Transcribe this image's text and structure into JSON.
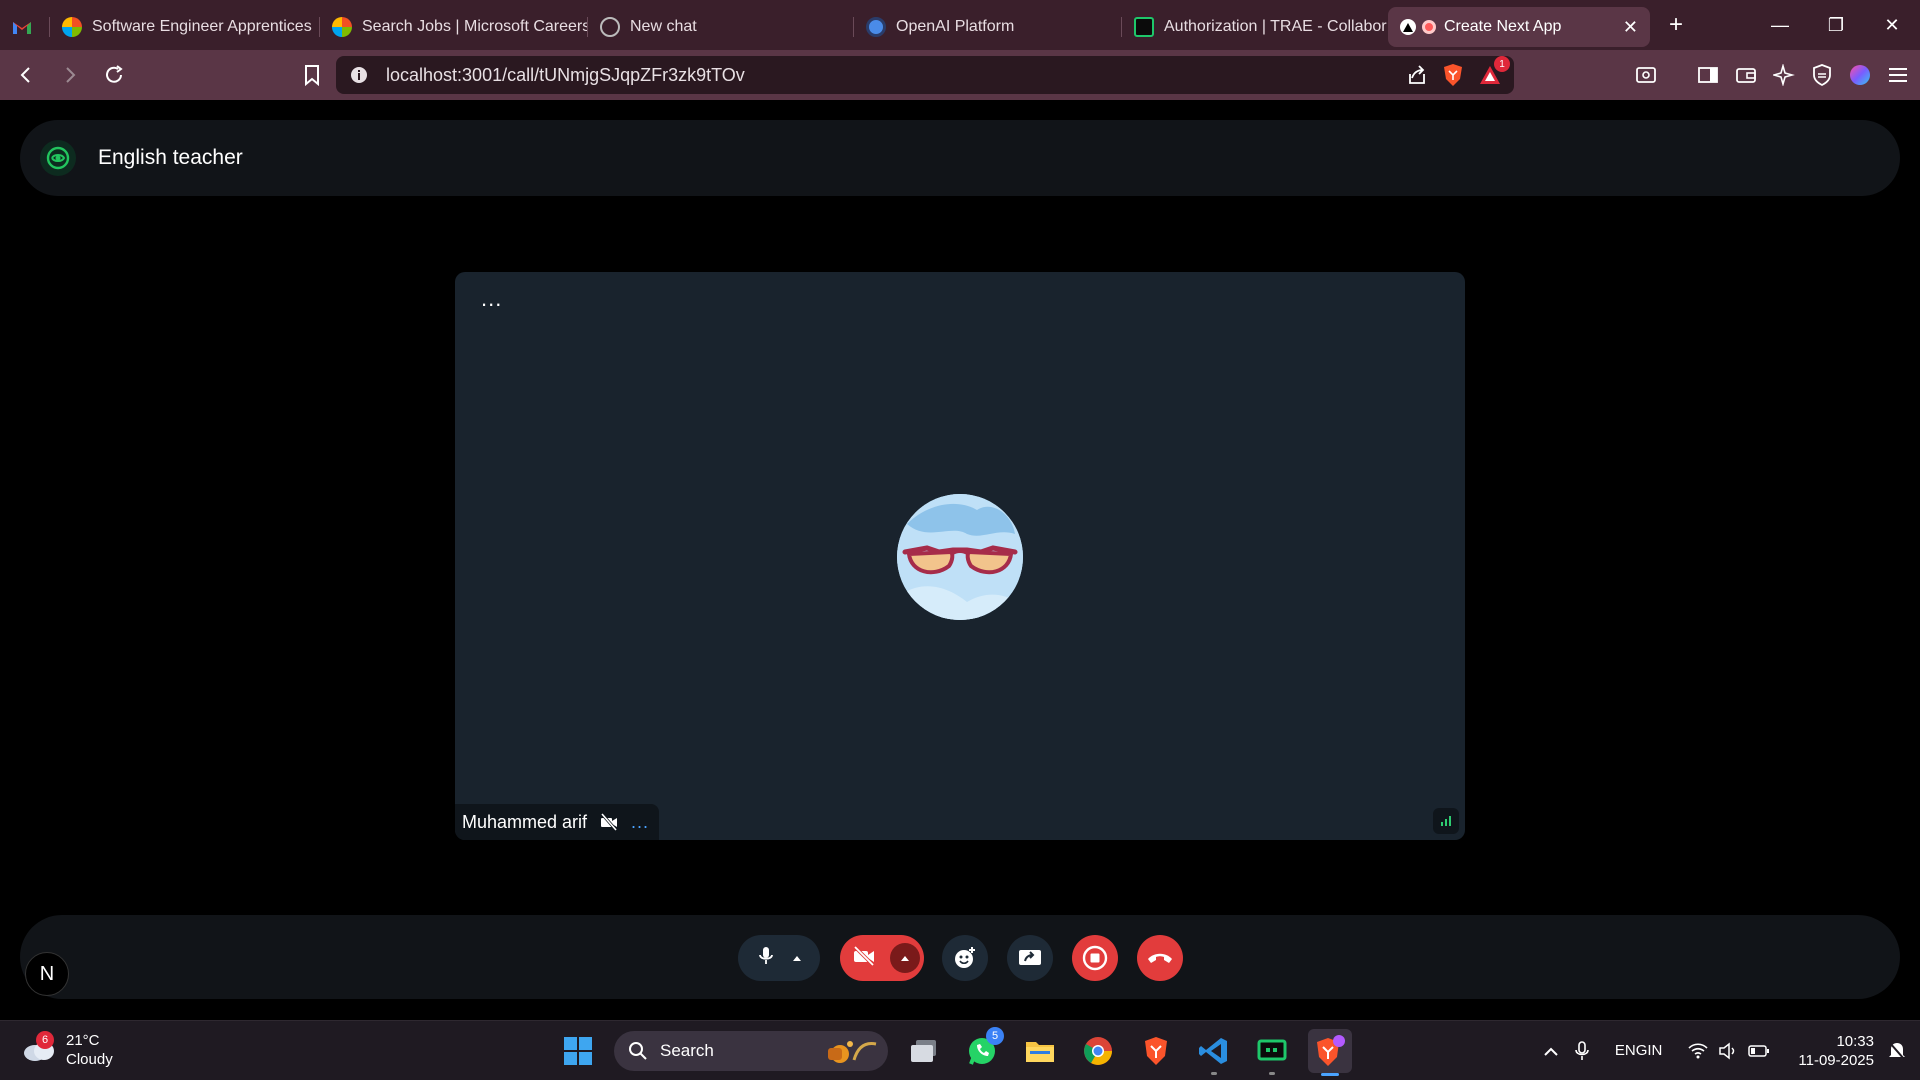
{
  "browser": {
    "tabs": [
      {
        "title": "",
        "icon": "gmail-icon"
      },
      {
        "title": "Software Engineer Apprentices",
        "icon": "microsoft-icon"
      },
      {
        "title": "Search Jobs | Microsoft Careers",
        "icon": "microsoft-icon"
      },
      {
        "title": "New chat",
        "icon": "openai-icon"
      },
      {
        "title": "OpenAI Platform",
        "icon": "openai-platform-icon"
      },
      {
        "title": "Authorization | TRAE - Collabor",
        "icon": "trae-icon"
      },
      {
        "title": "Create Next App",
        "icon": "nextjs-icon",
        "active": true
      }
    ],
    "url": "localhost:3001/call/tUNmjgSJqpZFr3zk9tTOv",
    "brave_alert_count": "1",
    "accent": "#5a3646"
  },
  "app": {
    "header_title": "English teacher",
    "tile_menu": "...",
    "participant_name": "Muhammed arif",
    "participant_menu": "...",
    "user_initial": "N",
    "colors": {
      "danger": "#e23c3c",
      "tile": "#19232d",
      "bar": "#111418",
      "signal": "#2ecc71"
    }
  },
  "taskbar": {
    "weather_temp": "21°C",
    "weather_desc": "Cloudy",
    "weather_badge": "6",
    "search_label": "Search",
    "whatsapp_badge": "5",
    "lang_line1": "ENG",
    "lang_line2": "IN",
    "time": "10:33",
    "date": "11-09-2025"
  }
}
